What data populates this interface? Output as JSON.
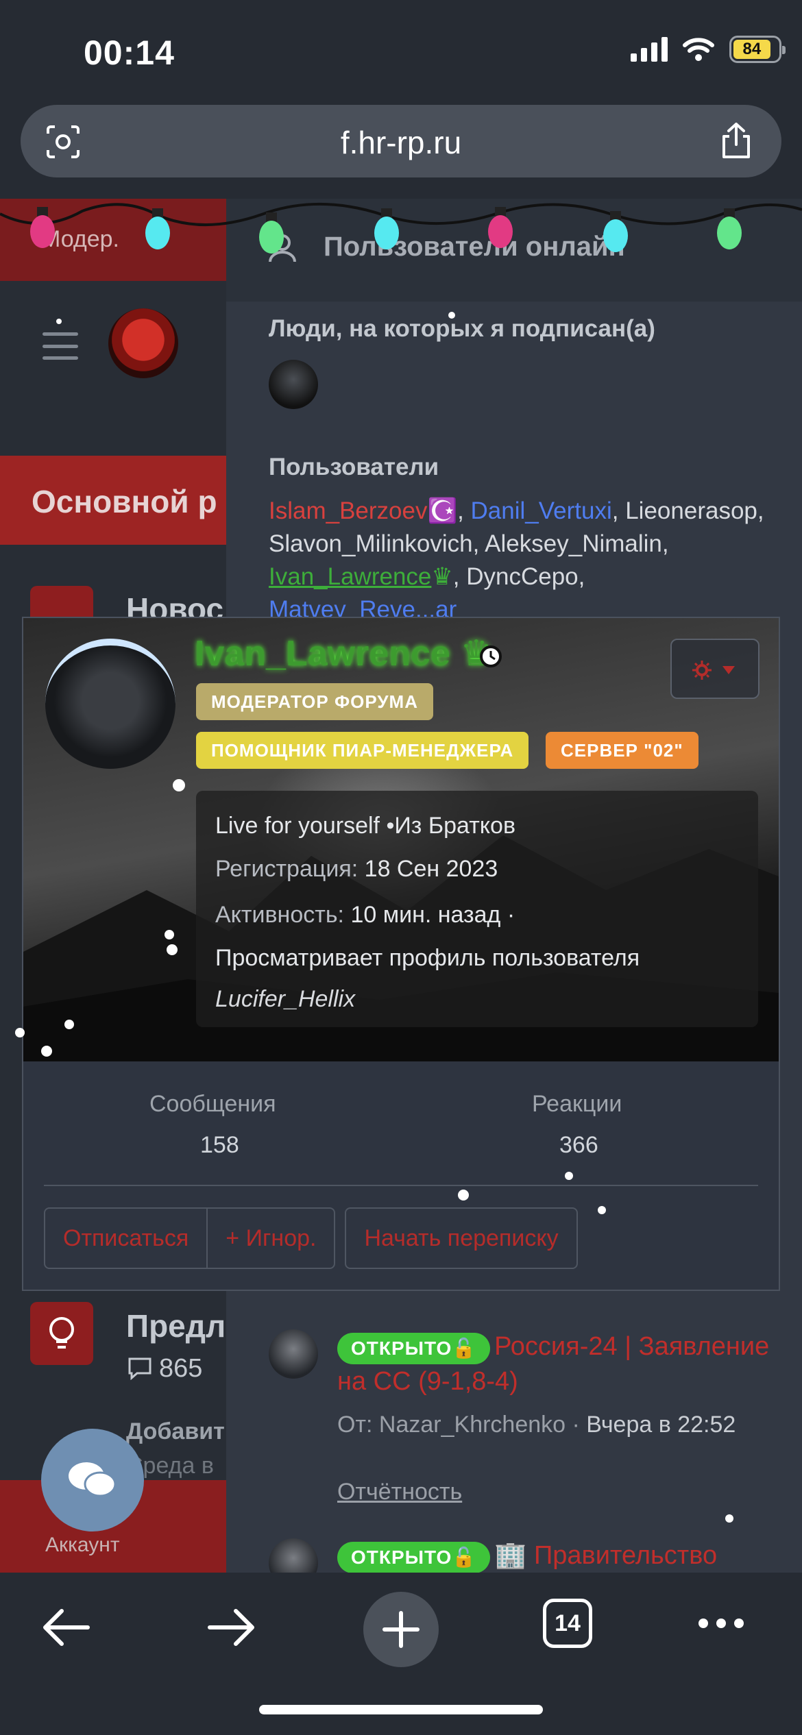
{
  "status_bar": {
    "time": "00:14",
    "battery": "84"
  },
  "browser": {
    "url": "f.hr-rp.ru",
    "tab_count": "14"
  },
  "sidebar": {
    "moder_label": "Модер.",
    "section_title": "Основной р",
    "items": [
      {
        "title": "Новос"
      },
      {
        "title": "Предл",
        "count": "865",
        "sub_title": "Добавит",
        "sub_text": "Среда в"
      }
    ],
    "account_label": "Аккаунт"
  },
  "online": {
    "title": "Пользователи онлайн",
    "followed_title": "Люди, на которых я подписан(а)",
    "users_title": "Пользователи",
    "users": [
      {
        "name": "Islam_Berzoev",
        "suffix": "☪️",
        "style": "red"
      },
      {
        "name": "Danil_Vertuxi",
        "style": "blue"
      },
      {
        "name": "Lieonerasop",
        "style": "plain"
      },
      {
        "name": "Slavon_Milinkovich",
        "style": "plain"
      },
      {
        "name": "Aleksey_Nimalin",
        "style": "plain"
      },
      {
        "name": "Ivan_Lawrence",
        "suffix": "♛",
        "style": "green"
      },
      {
        "name": "DyncCepo",
        "style": "plain"
      },
      {
        "name": "Matvey_Reve...ar",
        "style": "blue"
      }
    ]
  },
  "profile_card": {
    "name": "Ivan_Lawrence",
    "crown": "♛",
    "roles": {
      "moderator": "МОДЕРАТОР ФОРУМА",
      "pr_helper": "ПОМОЩНИК ПИАР-МЕНЕДЖЕРА",
      "server": "СЕРВЕР \"02\""
    },
    "status_text": "Live for yourself",
    "from_text": "•Из Братков",
    "registration_label": "Регистрация:",
    "registration_value": "18 Сен 2023",
    "activity_label": "Активность:",
    "activity_value": "10 мин. назад ·",
    "viewing_text": "Просматривает профиль пользователя",
    "viewing_user": "Lucifer_Hellix",
    "stats": {
      "messages_label": "Сообщения",
      "messages_value": "158",
      "reactions_label": "Реакции",
      "reactions_value": "366"
    },
    "buttons": {
      "unfollow": "Отписаться",
      "ignore": "+ Игнор.",
      "message": "Начать переписку"
    }
  },
  "threads": [
    {
      "badge": "ОТКРЫТО🔓",
      "title": "Россия-24 | Заявление на СС (9-1,8-4)",
      "from_label": "От: Nazar_Khrchenko ·",
      "date": "Вчера в 22:52",
      "category": "Отчётность"
    },
    {
      "badge": "ОТКРЫТО🔓",
      "title": "🏢 Правительство"
    }
  ],
  "colors": {
    "accent_red": "#c12e2b",
    "open_green": "#3ec43a",
    "role_mod": "#b9aa6a",
    "role_pr": "#e3d341",
    "role_server": "#ec8a35"
  }
}
